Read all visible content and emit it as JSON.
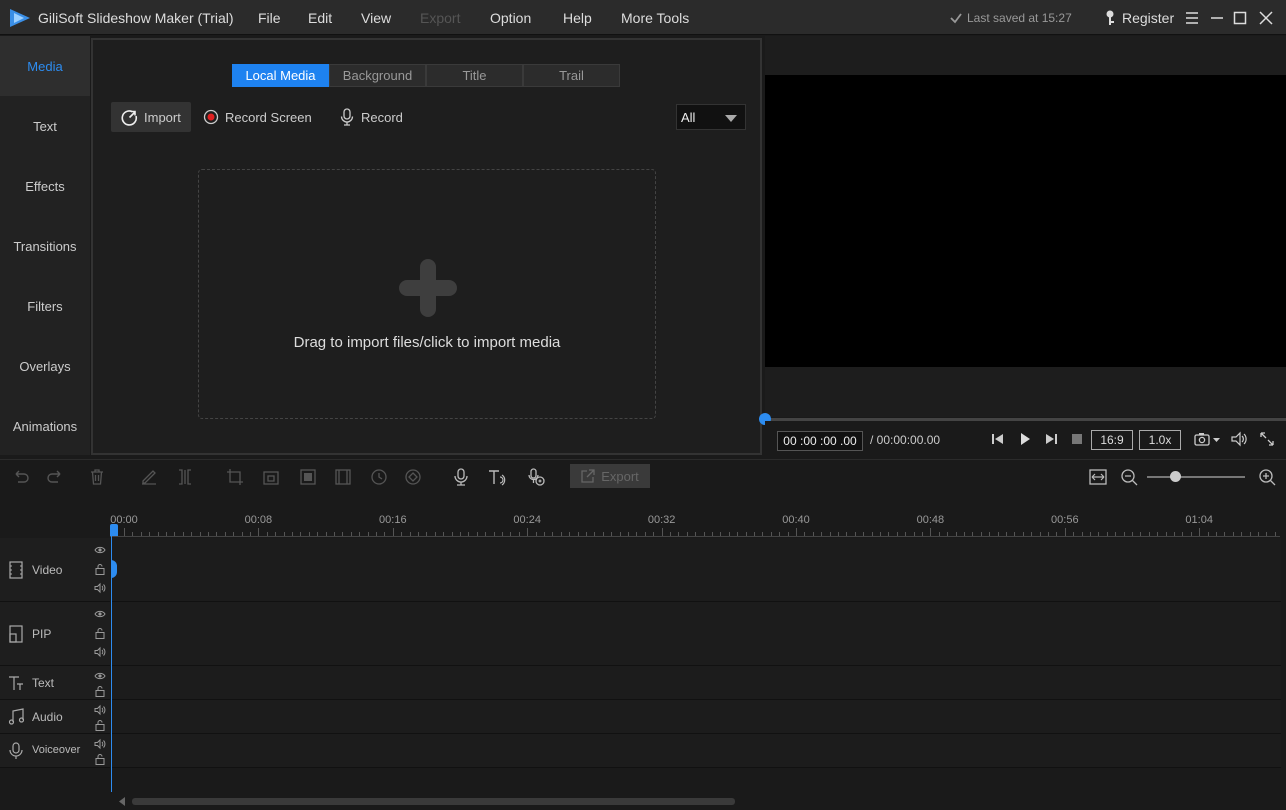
{
  "titlebar": {
    "app_title": "GiliSoft Slideshow Maker (Trial)",
    "menu": [
      "File",
      "Edit",
      "View",
      "Export",
      "Option",
      "Help",
      "More Tools"
    ],
    "last_saved": "Last saved at 15:27",
    "register": "Register"
  },
  "sidebar": {
    "items": [
      "Media",
      "Text",
      "Effects",
      "Transitions",
      "Filters",
      "Overlays",
      "Animations"
    ],
    "active": "Media"
  },
  "media": {
    "tabs": [
      "Local Media",
      "Background",
      "Title",
      "Trail"
    ],
    "import_label": "Import",
    "record_screen_label": "Record Screen",
    "record_label": "Record",
    "filter_value": "All",
    "drop_text": "Drag to import files/click to import media"
  },
  "player": {
    "timecode": "00 :00 :00 .00",
    "duration": "/ 00:00:00.00",
    "aspect": "16:9",
    "speed": "1.0x"
  },
  "timeline": {
    "export_label": "Export",
    "ticks": [
      "00:00",
      "00:08",
      "00:16",
      "00:24",
      "00:32",
      "00:40",
      "00:48",
      "00:56",
      "01:04"
    ],
    "tracks": [
      "Video",
      "PIP",
      "Text",
      "Audio",
      "Voiceover"
    ]
  },
  "colors": {
    "accent": "#2d8cf0",
    "record_red": "#e02020"
  },
  "icons": [
    "app-logo-icon",
    "check-icon",
    "key-icon",
    "menu-icon",
    "minimize-icon",
    "maximize-icon",
    "close-icon",
    "import-icon",
    "record-screen-icon",
    "microphone-icon",
    "plus-icon",
    "play-icon",
    "stop-icon",
    "snapshot-icon",
    "volume-icon",
    "fullscreen-icon",
    "undo-icon",
    "redo-icon",
    "delete-icon",
    "zoom-in-icon",
    "zoom-out-icon"
  ]
}
